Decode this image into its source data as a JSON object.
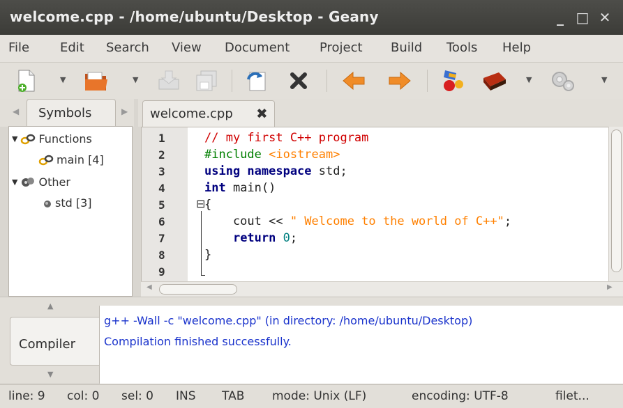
{
  "window": {
    "title": "welcome.cpp - /home/ubuntu/Desktop - Geany",
    "controls": {
      "minimize": "_",
      "maximize": "□",
      "close": "✕"
    }
  },
  "menu": [
    "File",
    "Edit",
    "Search",
    "View",
    "Document",
    "Project",
    "Build",
    "Tools",
    "Help"
  ],
  "toolbar": [
    "new-file-icon",
    "open-file-icon",
    "save-icon",
    "save-all-icon",
    "reload-icon",
    "close-icon",
    "back-icon",
    "forward-icon",
    "compile-icon",
    "build-icon",
    "execute-icon"
  ],
  "sidebar": {
    "tab_label": "Symbols",
    "items": [
      {
        "label": "Functions",
        "expanded": "▼"
      },
      {
        "label": "main [4]"
      },
      {
        "label": "Other",
        "expanded": "▼"
      },
      {
        "label": "std [3]"
      }
    ]
  },
  "editor": {
    "tab_label": "welcome.cpp",
    "tab_close": "✖",
    "line_numbers": [
      "1",
      "2",
      "3",
      "4",
      "5",
      "6",
      "7",
      "8",
      "9"
    ],
    "lines": [
      "// my first C++ program",
      "#include <iostream>",
      "using namespace std;",
      "int main()",
      "{",
      "    cout << \" Welcome to the world of C++\";",
      "    return 0;",
      "}",
      ""
    ],
    "fold_marker": "⊟"
  },
  "messages": {
    "tab_label": "Compiler",
    "lines": [
      "g++ -Wall -c \"welcome.cpp\" (in directory: /home/ubuntu/Desktop)",
      "Compilation finished successfully."
    ]
  },
  "status": {
    "line": "line: 9",
    "col": "col: 0",
    "sel": "sel: 0",
    "ins": "INS",
    "tab": "TAB",
    "mode": "mode: Unix (LF)",
    "encoding": "encoding: UTF-8",
    "filetype": "filet..."
  },
  "colors": {
    "titlebar": "#3c3c38",
    "comment": "#d00000",
    "keyword": "#00007f",
    "preprocessor": "#007f00",
    "string": "#ff8000",
    "number": "#007f7f",
    "message": "#1a33cc"
  }
}
